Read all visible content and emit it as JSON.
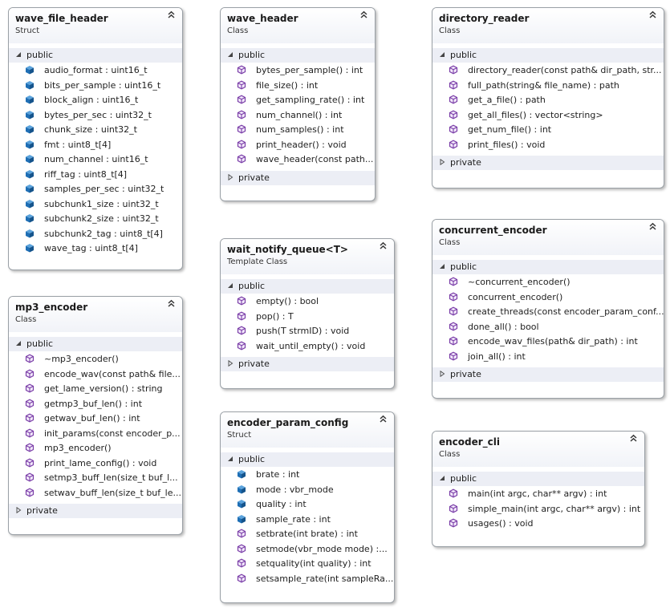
{
  "boxes": [
    {
      "id": "wave_file_header",
      "title": "wave_file_header",
      "stereotype": "Struct",
      "sections": [
        {
          "label": "public",
          "expanded": true,
          "kind": "field",
          "members": [
            "audio_format : uint16_t",
            "bits_per_sample : uint16_t",
            "block_align : uint16_t",
            "bytes_per_sec : uint32_t",
            "chunk_size : uint32_t",
            "fmt : uint8_t[4]",
            "num_channel : uint16_t",
            "riff_tag : uint8_t[4]",
            "samples_per_sec : uint32_t",
            "subchunk1_size : uint32_t",
            "subchunk2_size : uint32_t",
            "subchunk2_tag : uint8_t[4]",
            "wave_tag : uint8_t[4]"
          ]
        }
      ]
    },
    {
      "id": "wave_header",
      "title": "wave_header",
      "stereotype": "Class",
      "sections": [
        {
          "label": "public",
          "expanded": true,
          "kind": "method",
          "members": [
            "bytes_per_sample() : int",
            "file_size() : int",
            "get_sampling_rate() : int",
            "num_channel() : int",
            "num_samples() : int",
            "print_header() : void",
            "wave_header(const  path..."
          ]
        },
        {
          "label": "private",
          "expanded": false,
          "members": []
        }
      ]
    },
    {
      "id": "directory_reader",
      "title": "directory_reader",
      "stereotype": "Class",
      "sections": [
        {
          "label": "public",
          "expanded": true,
          "kind": "method",
          "members": [
            "directory_reader(const  path&  dir_path,  str...",
            "full_path(string& file_name) : path",
            "get_a_file() : path",
            "get_all_files() : vector<string>",
            "get_num_file() : int",
            "print_files() : void"
          ]
        },
        {
          "label": "private",
          "expanded": false,
          "members": []
        }
      ]
    },
    {
      "id": "concurrent_encoder",
      "title": "concurrent_encoder",
      "stereotype": "Class",
      "sections": [
        {
          "label": "public",
          "expanded": true,
          "kind": "method",
          "members": [
            "~concurrent_encoder()",
            "concurrent_encoder()",
            "create_threads(const  encoder_param_conf...",
            "done_all() : bool",
            "encode_wav_files(path& dir_path) : int",
            "join_all() : int"
          ]
        },
        {
          "label": "private",
          "expanded": false,
          "members": []
        }
      ]
    },
    {
      "id": "mp3_encoder",
      "title": "mp3_encoder",
      "stereotype": "Class",
      "sections": [
        {
          "label": "public",
          "expanded": true,
          "kind": "method",
          "members": [
            "~mp3_encoder()",
            "encode_wav(const path&  file...",
            "get_lame_version() : string",
            "getmp3_buf_len() : int",
            "getwav_buf_len() : int",
            "init_params(const  encoder_p...",
            "mp3_encoder()",
            "print_lame_config() : void",
            "setmp3_buff_len(size_t  buf_l...",
            "setwav_buff_len(size_t  buf_le..."
          ]
        },
        {
          "label": "private",
          "expanded": false,
          "members": []
        }
      ]
    },
    {
      "id": "wait_notify_queue",
      "title": "wait_notify_queue<T>",
      "stereotype": "Template Class",
      "sections": [
        {
          "label": "public",
          "expanded": true,
          "kind": "method",
          "members": [
            "empty() : bool",
            "pop() : T",
            "push(T strmID) : void",
            "wait_until_empty() : void"
          ]
        },
        {
          "label": "private",
          "expanded": false,
          "members": []
        }
      ]
    },
    {
      "id": "encoder_param_config",
      "title": "encoder_param_config",
      "stereotype": "Struct",
      "sections": [
        {
          "label": "public",
          "expanded": true,
          "kind": "mixed",
          "members": [
            "brate : int",
            "mode : vbr_mode",
            "quality : int",
            "sample_rate : int",
            "setbrate(int brate) : int",
            "setmode(vbr_mode  mode)  :...",
            "setquality(int quality) : int",
            "setsample_rate(int  sampleRa..."
          ],
          "member_kinds": [
            "field",
            "field",
            "field",
            "field",
            "method",
            "method",
            "method",
            "method"
          ]
        }
      ]
    },
    {
      "id": "encoder_cli",
      "title": "encoder_cli",
      "stereotype": "Class",
      "sections": [
        {
          "label": "public",
          "expanded": true,
          "kind": "method",
          "members": [
            "main(int argc, char** argv) : int",
            "simple_main(int argc, char** argv) : int",
            "usages() : void"
          ]
        }
      ]
    }
  ],
  "icons": {
    "collapse": "double-chevron-up-icon",
    "expanded": "triangle-expanded-icon",
    "collapsed": "triangle-collapsed-icon",
    "field": "field-icon",
    "method": "method-icon"
  },
  "colors": {
    "field_icon": "#1f6fb5",
    "method_icon": "#7b3fa8",
    "section_bg": "#eceef5",
    "border": "#9aa0a6"
  }
}
